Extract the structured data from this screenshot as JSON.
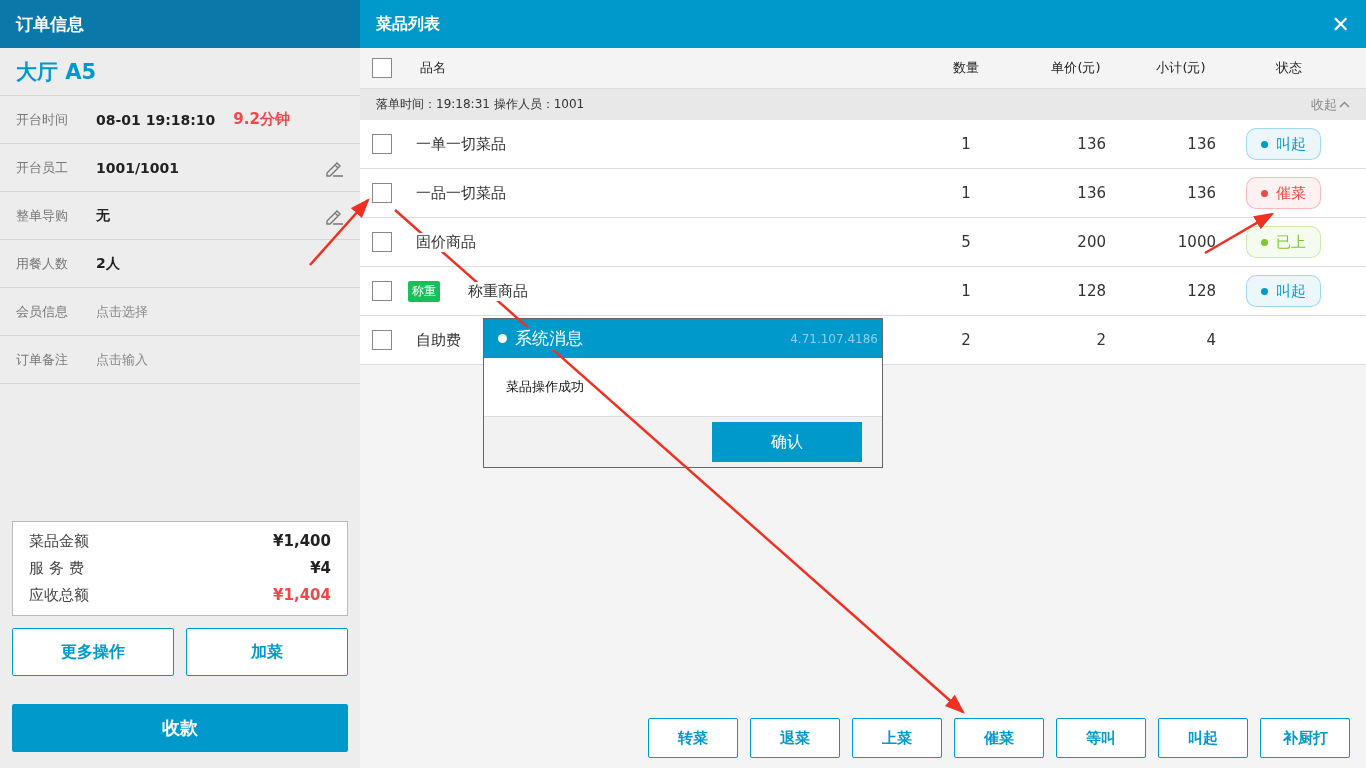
{
  "order_panel": {
    "title": "订单信息",
    "table_name": "大厅 A5",
    "fields": [
      {
        "label": "开台时间",
        "value": "08-01 19:18:10",
        "extra": "9.2分钟",
        "editable": false
      },
      {
        "label": "开台员工",
        "value": "1001/1001",
        "editable": true
      },
      {
        "label": "整单导购",
        "value": "无",
        "editable": true
      },
      {
        "label": "用餐人数",
        "value": "2人",
        "editable": false
      },
      {
        "label": "会员信息",
        "placeholder": "点击选择",
        "editable": false
      },
      {
        "label": "订单备注",
        "placeholder": "点击输入",
        "editable": false
      }
    ],
    "summary": [
      {
        "label": "菜品金额",
        "value": "¥1,400",
        "highlight": false
      },
      {
        "label": "服 务 费",
        "value": "¥4",
        "highlight": false
      },
      {
        "label": "应收总额",
        "value": "¥1,404",
        "highlight": true
      }
    ],
    "buttons": [
      "更多操作",
      "加菜"
    ],
    "pay_button": "收款"
  },
  "dish_panel": {
    "title": "菜品列表",
    "close": "✕",
    "select_all": {
      "checked": false
    },
    "columns": [
      "品名",
      "数量",
      "单价(元)",
      "小计(元)",
      "状态"
    ],
    "group": {
      "info": "落单时间：19:18:31  操作人员：1001",
      "toggle": "收起"
    },
    "rows": [
      {
        "checked": false,
        "name": "一单一切菜品",
        "qty": "1",
        "price": "136",
        "subtotal": "136",
        "status": {
          "label": "叫起",
          "color": "#0099cc"
        }
      },
      {
        "checked": false,
        "name": "一品一切菜品",
        "qty": "1",
        "price": "136",
        "subtotal": "136",
        "status": {
          "label": "催菜",
          "color": "#f04848"
        }
      },
      {
        "checked": false,
        "name": "固价商品",
        "qty": "5",
        "price": "200",
        "subtotal": "1000",
        "status": {
          "label": "已上",
          "color": "#7cc832"
        }
      },
      {
        "checked": false,
        "tag": "称重",
        "name": "称重商品",
        "qty": "1",
        "price": "128",
        "subtotal": "128",
        "status": {
          "label": "叫起",
          "color": "#0099cc"
        }
      },
      {
        "checked": false,
        "name": "自助费",
        "qty": "2",
        "price": "2",
        "subtotal": "4"
      }
    ],
    "actions": [
      "转菜",
      "退菜",
      "上菜",
      "催菜",
      "等叫",
      "叫起",
      "补厨打"
    ]
  },
  "dialog": {
    "title": "系统消息",
    "version": "4.71.107.4186",
    "message": "菜品操作成功",
    "confirm": "确认"
  }
}
